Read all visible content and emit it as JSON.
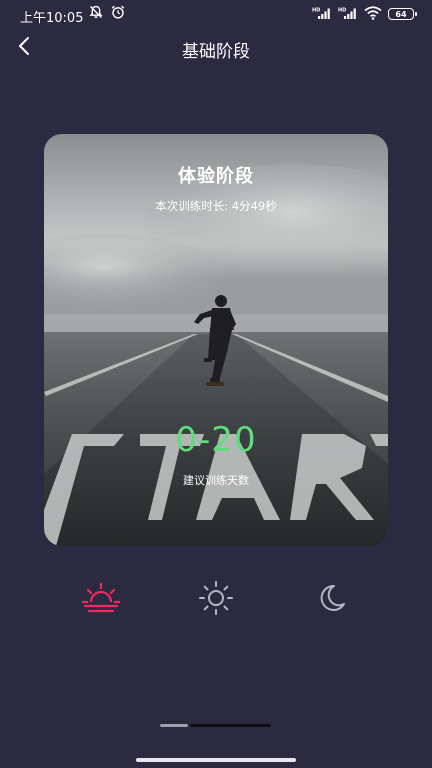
{
  "status_bar": {
    "time": "上午10:05",
    "battery_level": "64",
    "icons_left": [
      "mute-bell-icon",
      "alarm-icon"
    ],
    "icons_right": [
      "signal-hd-1-icon",
      "signal-hd-2-icon",
      "wifi-icon",
      "battery-icon"
    ]
  },
  "header": {
    "title": "基础阶段",
    "back_icon": "chevron-left-icon"
  },
  "card": {
    "title": "体验阶段",
    "duration": "本次训练时长: 4分49秒",
    "range": "0-20",
    "range_caption": "建议训练天数",
    "background": "runner-on-road-image",
    "road_text": "START"
  },
  "time_of_day": {
    "items": [
      {
        "icon": "sunrise-icon",
        "active": true
      },
      {
        "icon": "sun-icon",
        "active": false
      },
      {
        "icon": "moon-icon",
        "active": false
      }
    ],
    "active_color": "#ee2a5e",
    "inactive_color": "#b4b6c6"
  },
  "pager": {
    "pages": 2,
    "current": 1
  },
  "colors": {
    "background": "#2b2a40",
    "range_text": "#5fdc7c"
  }
}
